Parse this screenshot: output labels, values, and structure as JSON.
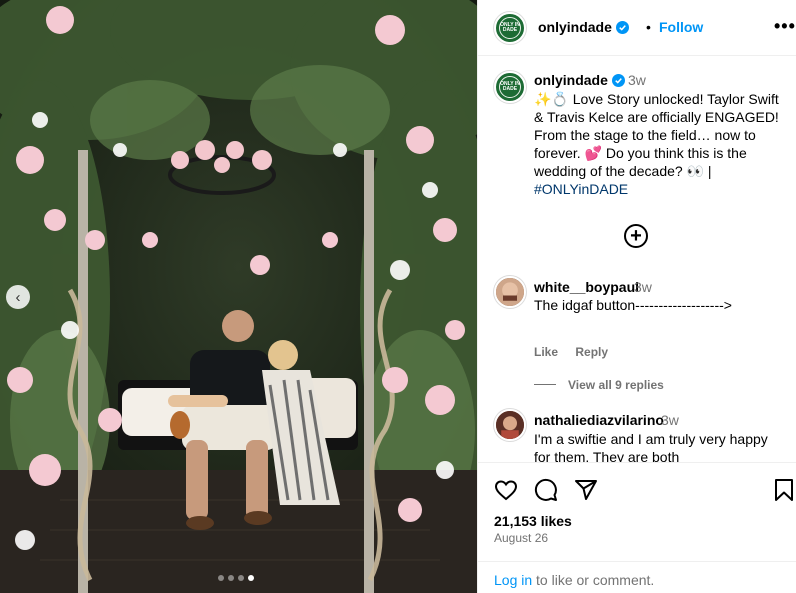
{
  "post": {
    "username": "onlyindade",
    "follow_label": "Follow",
    "separator": "•",
    "more_label": "•••",
    "avatar_text": "ONLY IN DADE"
  },
  "carousel": {
    "total_slides": 4,
    "active_slide": 4,
    "prev_label": "‹"
  },
  "caption": {
    "username": "onlyindade",
    "time": "3w",
    "emoji_prefix": "✨💍",
    "text": "Love Story unlocked! Taylor Swift & Travis Kelce are officially ENGAGED! From the stage to the field… now to forever. 💕 Do you think this is the wedding of the decade? 👀 |",
    "hashtag": "#ONLYinDADE"
  },
  "load_more_label": "+",
  "comments": [
    {
      "username": "white__boypaul",
      "time": "3w",
      "text": "The idgaf button------------------->",
      "like_label": "Like",
      "reply_label": "Reply",
      "view_replies": "View all 9 replies"
    },
    {
      "username": "nathaliediazvilarino",
      "time": "3w",
      "text": "I'm a swiftie and I am truly very happy for them. They are both"
    }
  ],
  "footer": {
    "likes": "21,153 likes",
    "date": "August 26",
    "login_link": "Log in",
    "login_suffix": " to like or comment."
  },
  "icons": [
    "heart-icon",
    "comment-icon",
    "share-icon",
    "save-icon",
    "verified-icon",
    "more-icon",
    "plus-circle-icon",
    "chevron-left-icon"
  ],
  "colors": {
    "accent": "#0095f6",
    "secondary_text": "#737373",
    "hashtag": "#00376b",
    "avatar_green": "#1d6b34"
  }
}
